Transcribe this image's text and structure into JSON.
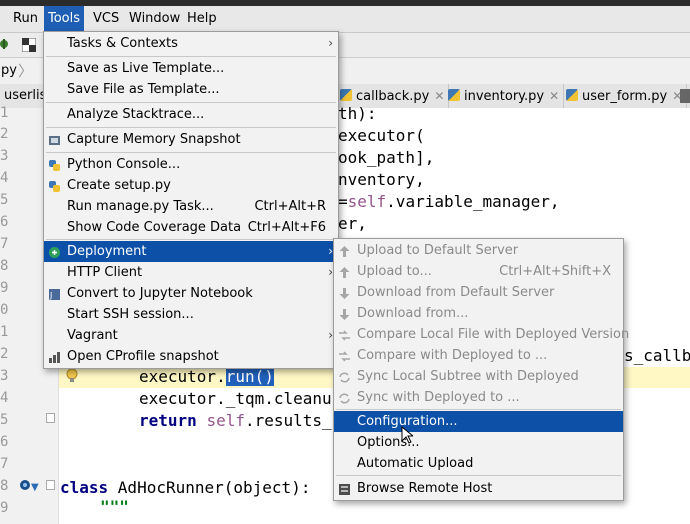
{
  "menubar": {
    "items": [
      {
        "label": "Run"
      },
      {
        "label": "Tools"
      },
      {
        "label": "VCS"
      },
      {
        "label": "Window"
      },
      {
        "label": "Help"
      }
    ]
  },
  "navbar": {
    "crumb": "py"
  },
  "tabs": [
    {
      "label": "userlist"
    },
    {
      "label": "callback.py"
    },
    {
      "label": "inventory.py"
    },
    {
      "label": "user_form.py"
    }
  ],
  "gutter": {
    "numbers": [
      "1",
      "2",
      "3",
      "4",
      "5",
      "6",
      "7",
      "8",
      "9",
      "0",
      "1",
      "2",
      "3",
      "4",
      "5",
      "6",
      "7",
      "8",
      "9"
    ]
  },
  "code": {
    "l1": "th):",
    "l2": "executor(",
    "l3": "ook_path],",
    "l4": "nventory,",
    "l5a": "=",
    "l5b": "self",
    "l5c": ".variable_manager,",
    "l6": "er,",
    "l12": "s_callb",
    "l13a": "executor.",
    "l13b": "run()",
    "l14": "executor._tqm.cleanu",
    "l15a": "return ",
    "l15b": "self",
    "l15c": ".results_",
    "l18a": "class ",
    "l18b": "AdHocRunner(object):",
    "l19": "\"\"\""
  },
  "tools_menu": {
    "items": [
      {
        "label": "Tasks & Contexts",
        "shortcut": "",
        "submenu": true
      },
      {
        "label": "Save as Live Template...",
        "shortcut": "",
        "submenu": false
      },
      {
        "label": "Save File as Template...",
        "shortcut": "",
        "submenu": false
      },
      {
        "label": "Analyze Stacktrace...",
        "shortcut": "",
        "submenu": false
      },
      {
        "label": "Capture Memory Snapshot",
        "shortcut": "",
        "submenu": false
      },
      {
        "label": "Python Console...",
        "shortcut": "",
        "submenu": false
      },
      {
        "label": "Create setup.py",
        "shortcut": "",
        "submenu": false
      },
      {
        "label": "Run manage.py Task...",
        "shortcut": "Ctrl+Alt+R",
        "submenu": false
      },
      {
        "label": "Show Code Coverage Data",
        "shortcut": "Ctrl+Alt+F6",
        "submenu": false
      },
      {
        "label": "Deployment",
        "shortcut": "",
        "submenu": true
      },
      {
        "label": "HTTP Client",
        "shortcut": "",
        "submenu": true
      },
      {
        "label": "Convert to Jupyter Notebook",
        "shortcut": "",
        "submenu": false
      },
      {
        "label": "Start SSH session...",
        "shortcut": "",
        "submenu": false
      },
      {
        "label": "Vagrant",
        "shortcut": "",
        "submenu": true
      },
      {
        "label": "Open CProfile snapshot",
        "shortcut": "",
        "submenu": false
      }
    ]
  },
  "deployment_menu": {
    "items": [
      {
        "label": "Upload to Default Server",
        "shortcut": ""
      },
      {
        "label": "Upload to...",
        "shortcut": "Ctrl+Alt+Shift+X"
      },
      {
        "label": "Download from Default Server",
        "shortcut": ""
      },
      {
        "label": "Download from...",
        "shortcut": ""
      },
      {
        "label": "Compare Local File with Deployed Version",
        "shortcut": ""
      },
      {
        "label": "Compare with Deployed to ...",
        "shortcut": ""
      },
      {
        "label": "Sync Local Subtree with Deployed",
        "shortcut": ""
      },
      {
        "label": "Sync with Deployed to ...",
        "shortcut": ""
      },
      {
        "label": "Configuration...",
        "shortcut": ""
      },
      {
        "label": "Options...",
        "shortcut": ""
      },
      {
        "label": "Automatic Upload",
        "shortcut": ""
      },
      {
        "label": "Browse Remote Host",
        "shortcut": ""
      }
    ]
  },
  "colors": {
    "highlight": "#0d50a8",
    "menu_bg": "#f2f2f2",
    "keyword": "#000080",
    "self": "#94558d"
  }
}
